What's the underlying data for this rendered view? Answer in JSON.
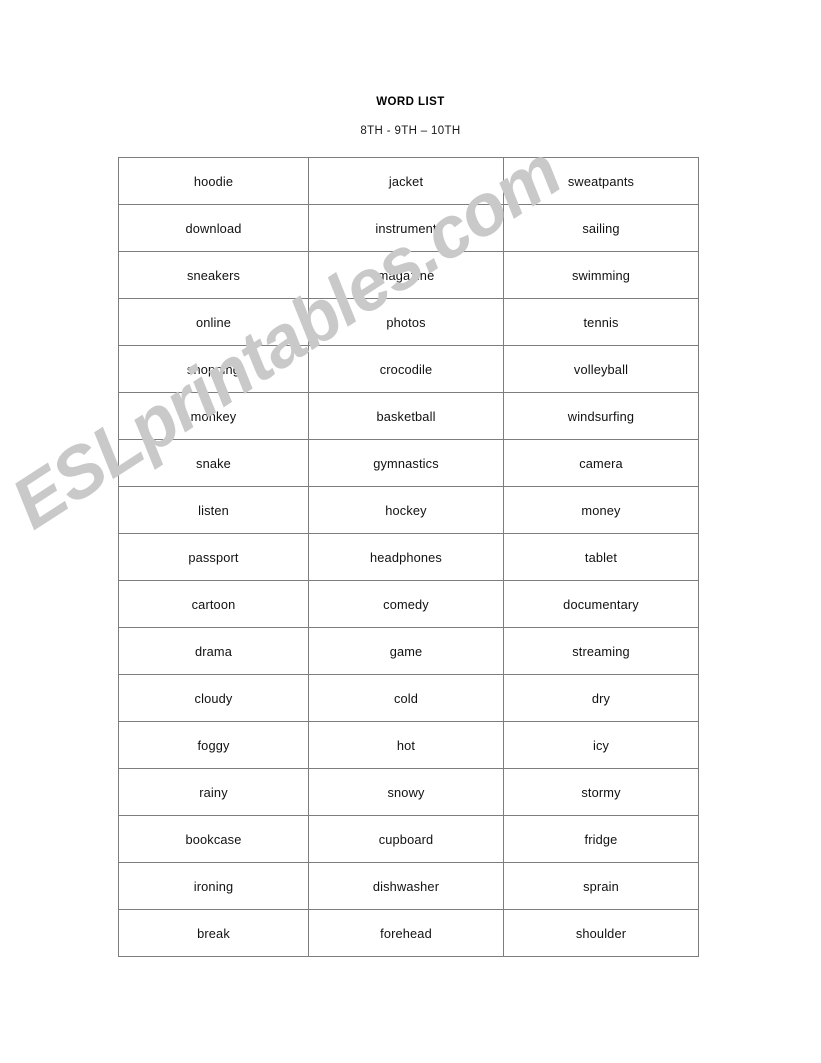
{
  "document": {
    "title": "WORD LIST",
    "subtitle": "8TH - 9TH – 10TH"
  },
  "watermark": {
    "text": "ESLprintables.com",
    "color": "#c9c9c9"
  },
  "colors": {
    "page_background": "#ffffff",
    "table_border": "#7d7d7d",
    "text": "#111111"
  },
  "table": {
    "columns": 3,
    "row_count": 16,
    "rows": [
      [
        "hoodie",
        "jacket",
        "sweatpants"
      ],
      [
        "download",
        "instrument",
        "sailing"
      ],
      [
        "sneakers",
        "magazine",
        "swimming"
      ],
      [
        "online",
        "photos",
        "tennis"
      ],
      [
        "shopping",
        "crocodile",
        "volleyball"
      ],
      [
        "monkey",
        "basketball",
        "windsurfing"
      ],
      [
        "snake",
        "gymnastics",
        "camera"
      ],
      [
        "listen",
        "hockey",
        "money"
      ],
      [
        "passport",
        "headphones",
        "tablet"
      ],
      [
        "cartoon",
        "comedy",
        "documentary"
      ],
      [
        "drama",
        "game",
        "streaming"
      ],
      [
        "cloudy",
        "cold",
        "dry"
      ],
      [
        "foggy",
        "hot",
        "icy"
      ],
      [
        "rainy",
        "snowy",
        "stormy"
      ],
      [
        "bookcase",
        "cupboard",
        "fridge"
      ],
      [
        "ironing",
        "dishwasher",
        "sprain"
      ],
      [
        "break",
        "forehead",
        "shoulder"
      ]
    ]
  }
}
